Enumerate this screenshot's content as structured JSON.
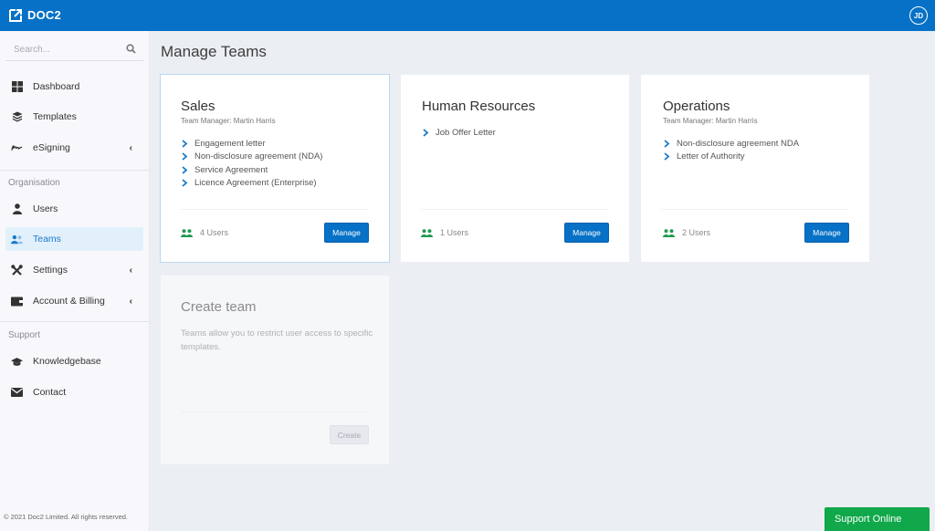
{
  "app": {
    "logo_text": "DOC2",
    "user_initials": "JD"
  },
  "colors": {
    "brand_blue": "#0671c6",
    "active_bg": "#e2f0fb",
    "users_green": "#1f9a4e",
    "support_green": "#10a84a"
  },
  "sidebar": {
    "search_placeholder": "Search...",
    "items": [
      {
        "label": "Dashboard",
        "icon": "dashboard-icon"
      },
      {
        "label": "Templates",
        "icon": "layers-icon"
      },
      {
        "label": "eSigning",
        "icon": "signature-icon",
        "has_submenu": true
      },
      {
        "label": "Users",
        "icon": "user-icon"
      },
      {
        "label": "Teams",
        "icon": "users-icon",
        "active": true
      },
      {
        "label": "Settings",
        "icon": "tools-icon",
        "has_submenu": true
      },
      {
        "label": "Account & Billing",
        "icon": "wallet-icon",
        "has_submenu": true
      },
      {
        "label": "Knowledgebase",
        "icon": "graduation-cap-icon"
      },
      {
        "label": "Contact",
        "icon": "envelope-icon"
      }
    ],
    "sections": {
      "organisation": "Organisation",
      "support": "Support"
    },
    "chevron": "‹",
    "copyright": "© 2021 Doc2 Limited. All rights reserved."
  },
  "main": {
    "title": "Manage Teams",
    "teams": [
      {
        "name": "Sales",
        "manager": "Team Manager: Martin Harris",
        "templates": [
          "Engagement letter",
          "Non-disclosure agreement (NDA)",
          "Service Agreement",
          "Licence Agreement (Enterprise)"
        ],
        "users": "4 Users",
        "button": "Manage"
      },
      {
        "name": "Human Resources",
        "manager": "",
        "templates": [
          "Job Offer Letter"
        ],
        "users": "1 Users",
        "button": "Manage"
      },
      {
        "name": "Operations",
        "manager": "Team Manager: Martin Harris",
        "templates": [
          "Non-disclosure agreement NDA",
          "Letter of Authority"
        ],
        "users": "2 Users",
        "button": "Manage"
      }
    ],
    "create": {
      "title": "Create team",
      "description": "Teams allow you to restrict user access to specific templates.",
      "button": "Create"
    }
  },
  "support_button": "Support Online"
}
